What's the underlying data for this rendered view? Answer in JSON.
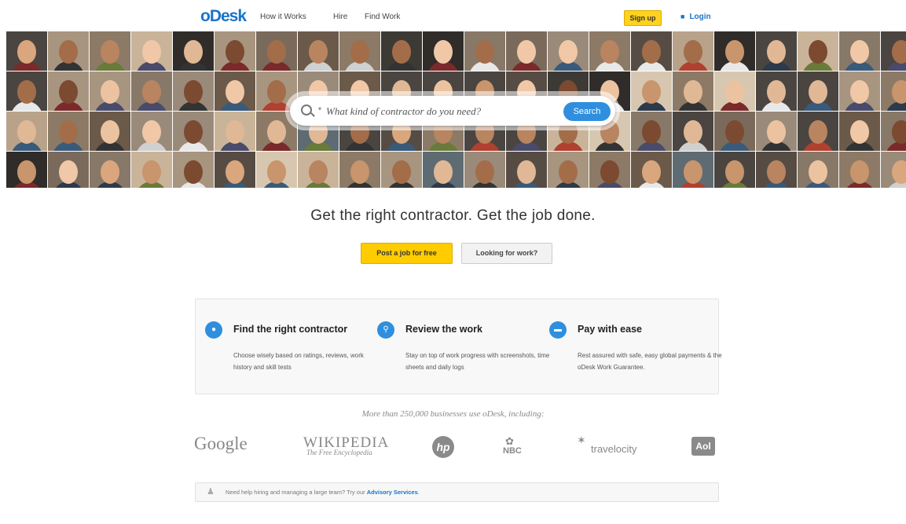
{
  "header": {
    "logo": "oDesk",
    "nav": [
      "How it Works",
      "Hire",
      "Find Work"
    ],
    "signup": "Sign up",
    "login": "Login"
  },
  "search": {
    "placeholder": "What kind of contractor do you need?",
    "button": "Search"
  },
  "tagline": "Get the right contractor. Get the job done.",
  "cta": {
    "post": "Post a job for free",
    "look": "Looking for work?"
  },
  "features": [
    {
      "title": "Find the right contractor",
      "icon": "person-icon",
      "description": "Choose wisely based on ratings, reviews, work history and skill tests"
    },
    {
      "title": "Review the work",
      "icon": "magnifier-icon",
      "description": "Stay on top of work progress with screenshots, time sheets and daily logs"
    },
    {
      "title": "Pay with ease",
      "icon": "card-icon",
      "description": "Rest assured with safe, easy global payments & the oDesk Work Guarantee."
    }
  ],
  "trust_text": "More than 250,000 businesses use oDesk, including:",
  "logos": {
    "google": "Google",
    "wikipedia": "WIKIPEDIA",
    "wikipedia_sub": "The Free Encyclopedia",
    "hp": "hp",
    "nbc": "NBC",
    "travelocity": "travelocity",
    "aol": "Aol"
  },
  "help": {
    "text": "Need help hiring and managing a large team? Try our",
    "link": "Advisory Services",
    "end": "."
  },
  "colors": {
    "brand_blue": "#1a73c9",
    "cta_yellow": "#ffcc00",
    "search_blue": "#2f8fde"
  }
}
